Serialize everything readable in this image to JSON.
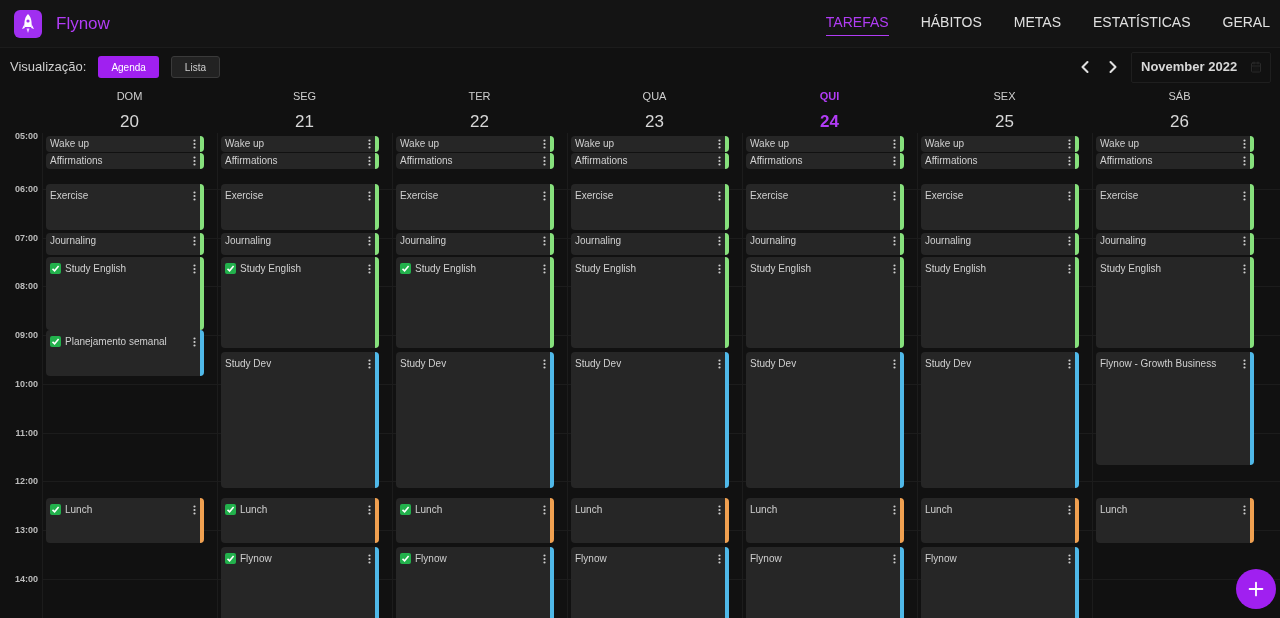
{
  "app": {
    "name": "Flynow"
  },
  "nav": [
    {
      "label": "TAREFAS",
      "selected": true
    },
    {
      "label": "HÁBITOS",
      "selected": false
    },
    {
      "label": "METAS",
      "selected": false
    },
    {
      "label": "ESTATÍSTICAS",
      "selected": false
    },
    {
      "label": "GERAL",
      "selected": false
    }
  ],
  "toolbar": {
    "label": "Visualização:",
    "views": [
      {
        "label": "Agenda",
        "selected": true
      },
      {
        "label": "Lista",
        "selected": false
      }
    ],
    "month": "November 2022"
  },
  "hours": [
    "05:00",
    "06:00",
    "07:00",
    "08:00",
    "09:00",
    "10:00",
    "11:00",
    "12:00",
    "13:00",
    "14:00"
  ],
  "days": [
    {
      "weekday": "DOM",
      "date": "20",
      "selected": false,
      "events": [
        {
          "title": "Wake up",
          "done": false,
          "color": "#86e07c"
        },
        {
          "title": "Affirmations",
          "done": false,
          "color": "#86e07c"
        },
        {
          "title": "Exercise",
          "done": false,
          "color": "#86e07c"
        },
        {
          "title": "Journaling",
          "done": false,
          "color": "#86e07c"
        },
        {
          "title": "Study English",
          "done": true,
          "color": "#86e07c"
        },
        {
          "title": "Planejamento semanal",
          "done": true,
          "color": "#4fb8e8"
        },
        {
          "title": "Lunch",
          "done": true,
          "color": "#f0a050"
        }
      ]
    },
    {
      "weekday": "SEG",
      "date": "21",
      "selected": false,
      "events": [
        {
          "title": "Wake up",
          "done": false,
          "color": "#86e07c"
        },
        {
          "title": "Affirmations",
          "done": false,
          "color": "#86e07c"
        },
        {
          "title": "Exercise",
          "done": false,
          "color": "#86e07c"
        },
        {
          "title": "Journaling",
          "done": false,
          "color": "#86e07c"
        },
        {
          "title": "Study English",
          "done": true,
          "color": "#86e07c"
        },
        {
          "title": "Study Dev",
          "done": false,
          "color": "#4fb8e8"
        },
        {
          "title": "Lunch",
          "done": true,
          "color": "#f0a050"
        },
        {
          "title": "Flynow",
          "done": true,
          "color": "#4fb8e8"
        }
      ]
    },
    {
      "weekday": "TER",
      "date": "22",
      "selected": false,
      "events": [
        {
          "title": "Wake up",
          "done": false,
          "color": "#86e07c"
        },
        {
          "title": "Affirmations",
          "done": false,
          "color": "#86e07c"
        },
        {
          "title": "Exercise",
          "done": false,
          "color": "#86e07c"
        },
        {
          "title": "Journaling",
          "done": false,
          "color": "#86e07c"
        },
        {
          "title": "Study English",
          "done": true,
          "color": "#86e07c"
        },
        {
          "title": "Study Dev",
          "done": false,
          "color": "#4fb8e8"
        },
        {
          "title": "Lunch",
          "done": true,
          "color": "#f0a050"
        },
        {
          "title": "Flynow",
          "done": true,
          "color": "#4fb8e8"
        }
      ]
    },
    {
      "weekday": "QUA",
      "date": "23",
      "selected": false,
      "events": [
        {
          "title": "Wake up",
          "done": false,
          "color": "#86e07c"
        },
        {
          "title": "Affirmations",
          "done": false,
          "color": "#86e07c"
        },
        {
          "title": "Exercise",
          "done": false,
          "color": "#86e07c"
        },
        {
          "title": "Journaling",
          "done": false,
          "color": "#86e07c"
        },
        {
          "title": "Study English",
          "done": false,
          "color": "#86e07c"
        },
        {
          "title": "Study Dev",
          "done": false,
          "color": "#4fb8e8"
        },
        {
          "title": "Lunch",
          "done": false,
          "color": "#f0a050"
        },
        {
          "title": "Flynow",
          "done": false,
          "color": "#4fb8e8"
        }
      ]
    },
    {
      "weekday": "QUI",
      "date": "24",
      "selected": true,
      "events": [
        {
          "title": "Wake up",
          "done": false,
          "color": "#86e07c"
        },
        {
          "title": "Affirmations",
          "done": false,
          "color": "#86e07c"
        },
        {
          "title": "Exercise",
          "done": false,
          "color": "#86e07c"
        },
        {
          "title": "Journaling",
          "done": false,
          "color": "#86e07c"
        },
        {
          "title": "Study English",
          "done": false,
          "color": "#86e07c"
        },
        {
          "title": "Study Dev",
          "done": false,
          "color": "#4fb8e8"
        },
        {
          "title": "Lunch",
          "done": false,
          "color": "#f0a050"
        },
        {
          "title": "Flynow",
          "done": false,
          "color": "#4fb8e8"
        }
      ]
    },
    {
      "weekday": "SEX",
      "date": "25",
      "selected": false,
      "events": [
        {
          "title": "Wake up",
          "done": false,
          "color": "#86e07c"
        },
        {
          "title": "Affirmations",
          "done": false,
          "color": "#86e07c"
        },
        {
          "title": "Exercise",
          "done": false,
          "color": "#86e07c"
        },
        {
          "title": "Journaling",
          "done": false,
          "color": "#86e07c"
        },
        {
          "title": "Study English",
          "done": false,
          "color": "#86e07c"
        },
        {
          "title": "Study Dev",
          "done": false,
          "color": "#4fb8e8"
        },
        {
          "title": "Lunch",
          "done": false,
          "color": "#f0a050"
        },
        {
          "title": "Flynow",
          "done": false,
          "color": "#4fb8e8"
        }
      ]
    },
    {
      "weekday": "SÁB",
      "date": "26",
      "selected": false,
      "events": [
        {
          "title": "Wake up",
          "done": false,
          "color": "#86e07c"
        },
        {
          "title": "Affirmations",
          "done": false,
          "color": "#86e07c"
        },
        {
          "title": "Exercise",
          "done": false,
          "color": "#86e07c"
        },
        {
          "title": "Journaling",
          "done": false,
          "color": "#86e07c"
        },
        {
          "title": "Study English",
          "done": false,
          "color": "#86e07c"
        },
        {
          "title": "Flynow - Growth Business",
          "done": false,
          "color": "#4fb8e8"
        },
        {
          "title": "Lunch",
          "done": false,
          "color": "#f0a050"
        }
      ]
    }
  ]
}
